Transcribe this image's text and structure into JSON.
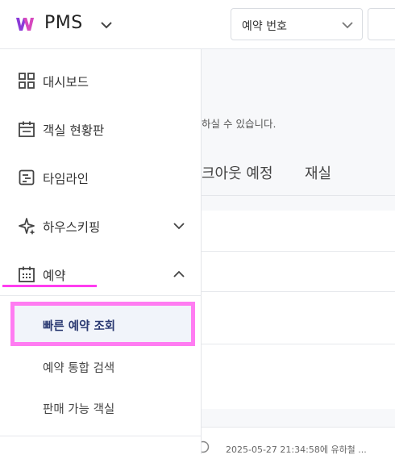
{
  "app": {
    "name": "PMS",
    "logo_icon": "w-logo-icon",
    "brand_colors": {
      "logo": "#8b3bd8",
      "highlight": "#ff3df0"
    }
  },
  "header": {
    "search_type_select": {
      "value": "예약 번호"
    }
  },
  "sidebar": {
    "items": [
      {
        "label": "대시보드",
        "icon": "grid-icon"
      },
      {
        "label": "객실 현황판",
        "icon": "calendar-icon"
      },
      {
        "label": "타임라인",
        "icon": "timeline-icon"
      },
      {
        "label": "하우스키핑",
        "icon": "sparkle-icon",
        "expandable": true,
        "expanded": false
      },
      {
        "label": "예약",
        "icon": "calendar-grid-icon",
        "expandable": true,
        "expanded": true
      }
    ],
    "sub_items": [
      {
        "label": "빠른 예약 조회",
        "active": true
      },
      {
        "label": "예약 통합 검색",
        "active": false
      },
      {
        "label": "판매 가능 객실",
        "active": false
      }
    ]
  },
  "main": {
    "hint_text": "하실 수 있습니다.",
    "tabs": [
      {
        "label": "크아웃 예정"
      },
      {
        "label": "재실"
      }
    ],
    "footer_text": "2025-05-27 21:34:58에 유하철 ..."
  }
}
